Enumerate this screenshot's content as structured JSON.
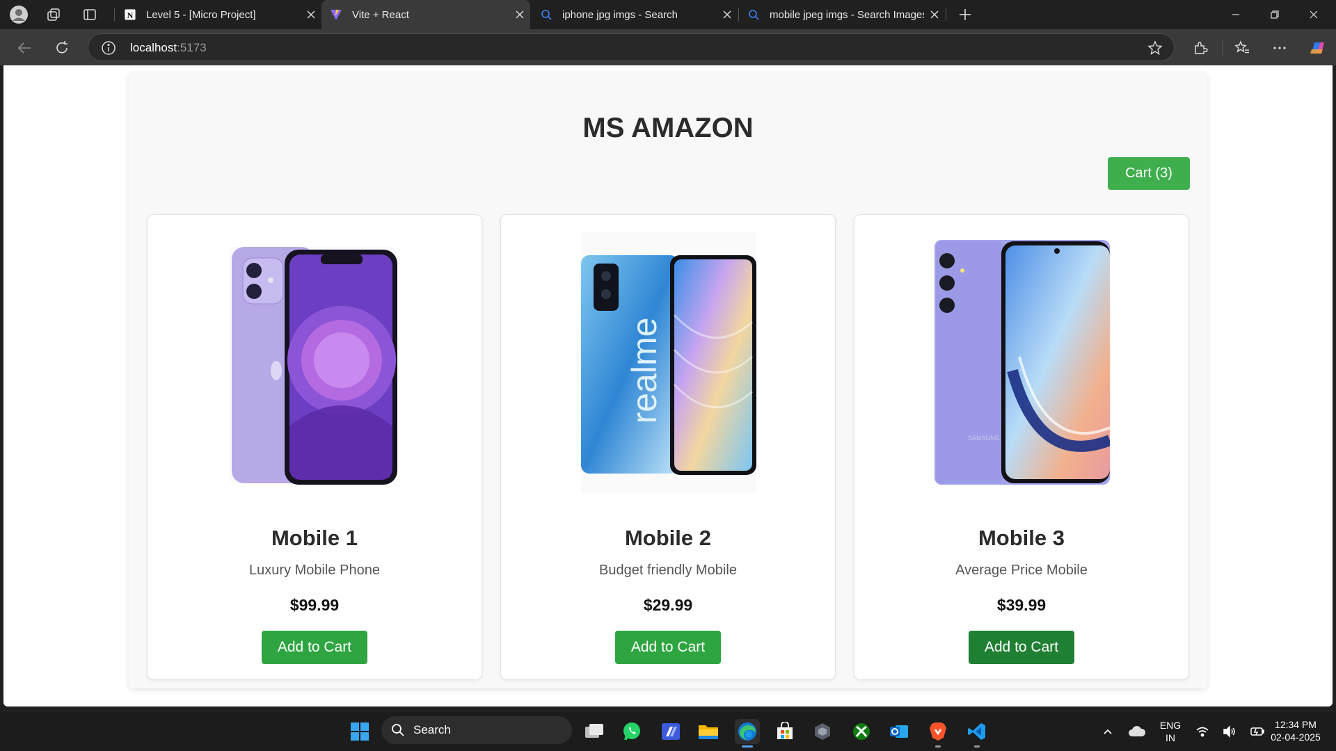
{
  "browser": {
    "tabs": [
      {
        "title": "Level 5 - [Micro Project]",
        "active": false
      },
      {
        "title": "Vite + React",
        "active": true
      },
      {
        "title": "iphone jpg imgs - Search",
        "active": false
      },
      {
        "title": "mobile jpeg imgs - Search Images",
        "active": false
      }
    ],
    "url_host": "localhost",
    "url_port": ":5173"
  },
  "page": {
    "title": "MS AMAZON",
    "cart_label": "Cart (3)",
    "products": [
      {
        "name": "Mobile 1",
        "description": "Luxury Mobile Phone",
        "price": "$99.99",
        "button": "Add to Cart",
        "image": "iphone-purple"
      },
      {
        "name": "Mobile 2",
        "description": "Budget friendly Mobile",
        "price": "$29.99",
        "button": "Add to Cart",
        "image": "realme-blue"
      },
      {
        "name": "Mobile 3",
        "description": "Average Price Mobile",
        "price": "$39.99",
        "button": "Add to Cart",
        "image": "samsung-lavender"
      }
    ]
  },
  "taskbar": {
    "search_label": "Search",
    "lang": "ENG",
    "region": "IN",
    "time": "12:34 PM",
    "date": "02-04-2025"
  },
  "colors": {
    "accent_green": "#2ea540",
    "cart_green": "#3fae4c",
    "hover_green": "#1f7f33"
  }
}
